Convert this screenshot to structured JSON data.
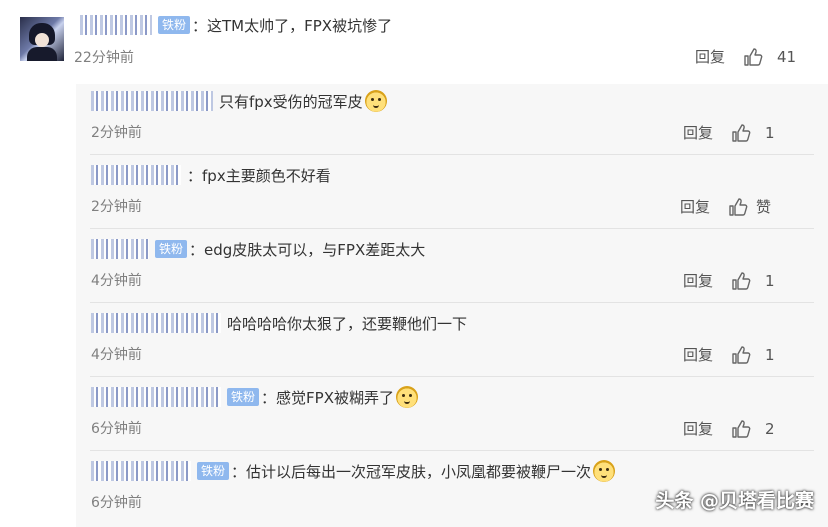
{
  "main_comment": {
    "badge": "铁粉",
    "text": "：这TM太帅了，FPX被坑惨了",
    "time": "22分钟前",
    "reply_label": "回复",
    "likes": "41"
  },
  "replies": [
    {
      "has_badge": false,
      "colon": "",
      "text": "只有fpx受伤的冠军皮",
      "emoji": true,
      "time": "2分钟前",
      "reply_label": "回复",
      "likes": "1"
    },
    {
      "has_badge": false,
      "colon": "：",
      "text": "fpx主要颜色不好看",
      "emoji": false,
      "time": "2分钟前",
      "reply_label": "回复",
      "likes": "赞"
    },
    {
      "has_badge": true,
      "badge": "铁粉",
      "colon": "：",
      "text": "edg皮肤太可以，与FPX差距太大",
      "emoji": false,
      "time": "4分钟前",
      "reply_label": "回复",
      "likes": "1"
    },
    {
      "has_badge": false,
      "colon": "",
      "text": "哈哈哈哈你太狠了，还要鞭他们一下",
      "emoji": false,
      "time": "4分钟前",
      "reply_label": "回复",
      "likes": "1"
    },
    {
      "has_badge": true,
      "badge": "铁粉",
      "colon": "：",
      "text": "感觉FPX被糊弄了",
      "emoji": true,
      "time": "6分钟前",
      "reply_label": "回复",
      "likes": "2"
    },
    {
      "has_badge": true,
      "badge": "铁粉",
      "colon": "：",
      "text": "估计以后每出一次冠军皮肤，小凤凰都要被鞭尸一次",
      "emoji": true,
      "time": "6分钟前",
      "reply_label": "",
      "likes": ""
    }
  ],
  "watermark": "头条 @贝塔看比赛"
}
